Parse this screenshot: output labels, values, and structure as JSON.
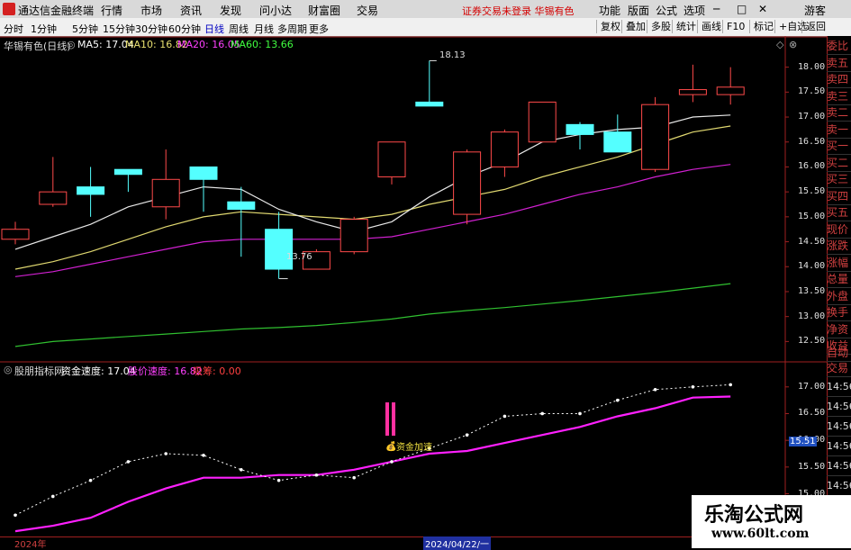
{
  "menubar": {
    "app_name": "通达信金融终端",
    "items": [
      "行情",
      "市场",
      "资讯",
      "发现",
      "问小达",
      "财富圈",
      "交易"
    ],
    "warning": "证券交易未登录   华锡有色",
    "right": [
      "功能",
      "版面",
      "公式",
      "选项"
    ],
    "guest": "游客"
  },
  "toolbar": {
    "periods": [
      "分时",
      "1分钟",
      "5分钟",
      "15分钟",
      "30分钟",
      "60分钟",
      "日线",
      "周线",
      "月线",
      "多周期",
      "更多"
    ],
    "active_period": "日线",
    "buttons": [
      "复权",
      "叠加",
      "多股",
      "统计",
      "画线",
      "F10",
      "标记",
      "+自选",
      "返回"
    ]
  },
  "main_chart": {
    "title": "华锡有色(日线)",
    "indicators": [
      {
        "label": "MA5: 17.04",
        "color": "#ffffff"
      },
      {
        "label": "MA10: 16.82",
        "color": "#e8e070"
      },
      {
        "label": "MA20: 16.05",
        "color": "#ff40ff"
      },
      {
        "label": "MA60: 13.66",
        "color": "#40ff40"
      }
    ],
    "y_ticks": [
      "18.00",
      "17.50",
      "17.00",
      "16.50",
      "16.00",
      "15.50",
      "15.00",
      "14.50",
      "14.00",
      "13.50",
      "13.00",
      "12.50"
    ],
    "high_label": "18.13",
    "low_label": "13.76"
  },
  "sub_chart": {
    "title": "股朋指标网",
    "line1": "资金速度: 17.04",
    "line2": "股价速度: 16.82",
    "line3": "吸筹: 0.00",
    "signal": "资金加速",
    "y_ticks": [
      "17.00",
      "16.50",
      "16.00",
      "15.50",
      "15.00"
    ],
    "current_value": "15.51"
  },
  "side_panel": {
    "items": [
      "委比",
      "卖五",
      "卖四",
      "卖三",
      "卖二",
      "卖一",
      "买一",
      "买二",
      "买三",
      "买四",
      "买五",
      "现价",
      "涨跌",
      "涨幅",
      "总量",
      "外盘",
      "换手",
      "净资",
      "收益"
    ],
    "bottom": [
      "自动",
      "交易"
    ],
    "times": [
      "14:56",
      "14:56",
      "14:56",
      "14:56",
      "14:56",
      "14:56",
      "14:56",
      "14:56"
    ]
  },
  "axis": {
    "year": "2024年",
    "cursor_date": "2024/04/22/一"
  },
  "watermark": {
    "line1": "乐淘公式网",
    "line2": "www.60lt.com"
  },
  "chart_data": {
    "type": "candlestick",
    "y_range": [
      12.2,
      18.3
    ],
    "candles": [
      {
        "o": 14.55,
        "c": 14.75,
        "h": 14.9,
        "l": 14.45
      },
      {
        "o": 15.25,
        "c": 15.5,
        "h": 16.2,
        "l": 15.2
      },
      {
        "o": 15.6,
        "c": 15.45,
        "h": 16.0,
        "l": 15.0
      },
      {
        "o": 15.95,
        "c": 15.85,
        "h": 15.95,
        "l": 15.5
      },
      {
        "o": 15.2,
        "c": 15.75,
        "h": 16.35,
        "l": 14.95
      },
      {
        "o": 16.0,
        "c": 15.75,
        "h": 16.0,
        "l": 15.1
      },
      {
        "o": 15.3,
        "c": 15.15,
        "h": 15.6,
        "l": 14.2
      },
      {
        "o": 14.75,
        "c": 13.95,
        "h": 15.1,
        "l": 13.76
      },
      {
        "o": 13.95,
        "c": 14.3,
        "h": 14.35,
        "l": 13.95
      },
      {
        "o": 14.3,
        "c": 14.95,
        "h": 15.0,
        "l": 14.25
      },
      {
        "o": 15.8,
        "c": 16.5,
        "h": 16.5,
        "l": 15.65
      },
      {
        "o": 17.3,
        "c": 17.22,
        "h": 18.13,
        "l": 17.22
      },
      {
        "o": 15.05,
        "c": 16.3,
        "h": 16.35,
        "l": 14.85
      },
      {
        "o": 16.0,
        "c": 16.7,
        "h": 16.75,
        "l": 15.8
      },
      {
        "o": 16.5,
        "c": 17.3,
        "h": 17.3,
        "l": 16.5
      },
      {
        "o": 16.85,
        "c": 16.65,
        "h": 16.9,
        "l": 16.35
      },
      {
        "o": 16.7,
        "c": 16.3,
        "h": 17.05,
        "l": 16.3
      },
      {
        "o": 15.95,
        "c": 17.25,
        "h": 17.4,
        "l": 15.9
      },
      {
        "o": 17.45,
        "c": 17.55,
        "h": 18.05,
        "l": 17.3
      },
      {
        "o": 17.45,
        "c": 17.6,
        "h": 18.0,
        "l": 17.25
      }
    ],
    "ma5": [
      14.35,
      14.6,
      14.85,
      15.2,
      15.4,
      15.6,
      15.55,
      15.15,
      14.9,
      14.7,
      14.9,
      15.4,
      15.8,
      16.1,
      16.5,
      16.65,
      16.75,
      16.8,
      17.0,
      17.04
    ],
    "ma10": [
      13.95,
      14.1,
      14.3,
      14.55,
      14.8,
      15.0,
      15.1,
      15.05,
      15.0,
      14.95,
      15.05,
      15.25,
      15.4,
      15.55,
      15.8,
      16.0,
      16.2,
      16.45,
      16.7,
      16.82
    ],
    "ma20": [
      13.8,
      13.9,
      14.05,
      14.2,
      14.35,
      14.5,
      14.55,
      14.55,
      14.55,
      14.55,
      14.6,
      14.75,
      14.9,
      15.05,
      15.25,
      15.45,
      15.6,
      15.8,
      15.95,
      16.05
    ],
    "ma60": [
      12.4,
      12.5,
      12.55,
      12.6,
      12.65,
      12.7,
      12.75,
      12.78,
      12.82,
      12.88,
      12.95,
      13.05,
      13.12,
      13.18,
      13.25,
      13.32,
      13.4,
      13.48,
      13.57,
      13.66
    ],
    "sub_range": [
      14.2,
      17.3
    ],
    "sub_fund_speed": [
      14.6,
      14.95,
      15.25,
      15.6,
      15.75,
      15.72,
      15.45,
      15.25,
      15.35,
      15.3,
      15.6,
      15.85,
      16.1,
      16.45,
      16.5,
      16.5,
      16.75,
      16.95,
      17.0,
      17.04
    ],
    "sub_price_speed": [
      14.3,
      14.4,
      14.55,
      14.85,
      15.1,
      15.3,
      15.3,
      15.35,
      15.35,
      15.45,
      15.6,
      15.75,
      15.8,
      15.95,
      16.1,
      16.25,
      16.45,
      16.6,
      16.8,
      16.82
    ]
  }
}
